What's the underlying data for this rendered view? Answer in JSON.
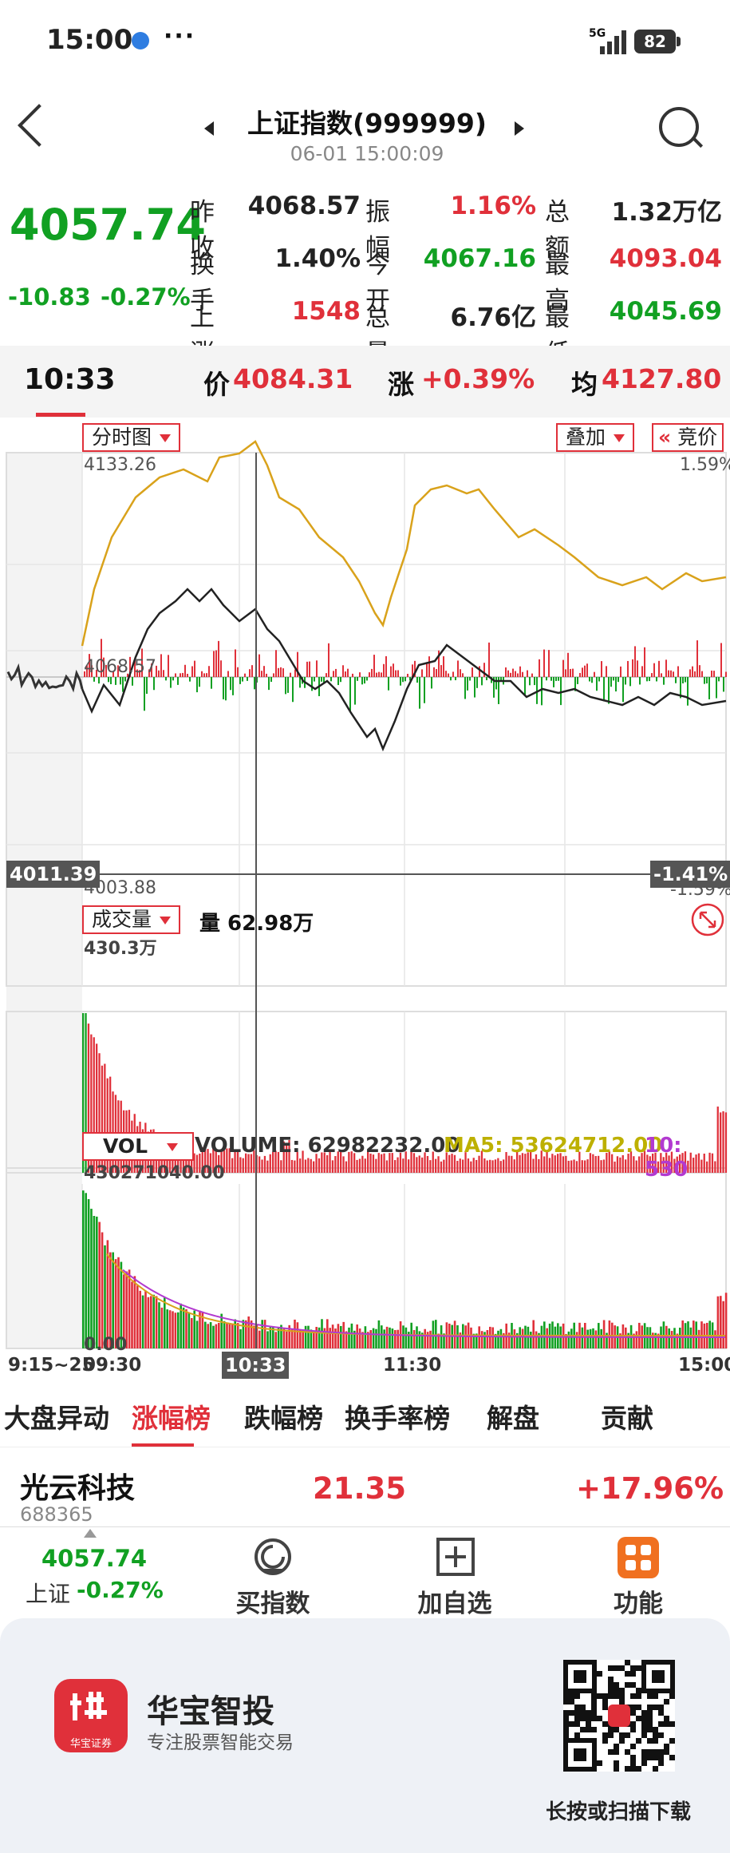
{
  "status": {
    "time": "15:00",
    "more": "···",
    "network": "5G",
    "battery": "82"
  },
  "header": {
    "title": "上证指数(999999)",
    "subtitle": "06-01 15:00:09"
  },
  "quote": {
    "price": "4057.74",
    "change": "-10.83",
    "change_pct": "-0.27%",
    "stats": [
      {
        "label": "昨收",
        "value": "4068.57",
        "color": "#222222"
      },
      {
        "label": "振幅",
        "value": "1.16%",
        "color": "#e0303a"
      },
      {
        "label": "总额",
        "value": "1.32万亿",
        "color": "#222222"
      },
      {
        "label": "换手",
        "value": "1.40%",
        "color": "#222222"
      },
      {
        "label": "今开",
        "value": "4067.16",
        "color": "#11a022"
      },
      {
        "label": "最高",
        "value": "4093.04",
        "color": "#e0303a"
      },
      {
        "label": "上涨数",
        "value": "1548",
        "color": "#e0303a"
      },
      {
        "label": "总量",
        "value": "6.76亿",
        "color": "#222222"
      },
      {
        "label": "最低",
        "value": "4045.69",
        "color": "#11a022"
      }
    ]
  },
  "strip": {
    "time": "10:33",
    "price_label": "价",
    "price": "4084.31",
    "chg_label": "涨",
    "chg": "+0.39%",
    "avg_label": "均",
    "avg": "4127.80"
  },
  "intraday": {
    "tag_chart": "分时图",
    "tag_overlay": "叠加",
    "tag_auction": "竞价",
    "y_top": "4133.26",
    "y_mid": "4068.57",
    "y_bottom": "4003.88",
    "pct_top": "1.59%",
    "pct_bottom": "-1.59%",
    "cursor_left": "4011.39",
    "cursor_right": "-1.41%"
  },
  "volume": {
    "tag": "成交量",
    "label": "量 62.98万",
    "max": "430.3万"
  },
  "vol": {
    "tag": "VOL",
    "volume": "VOLUME: 62982232.00",
    "ma5": "MA5: 53624712.00",
    "ma10": "10: 530",
    "max": "430271040.00",
    "min": "0.00"
  },
  "xaxis": {
    "t0": "9:15~25",
    "t1": "09:30",
    "cursor": "10:33",
    "t2": "11:30",
    "t3": "15:00"
  },
  "tabs": [
    "大盘异动",
    "涨幅榜",
    "跌幅榜",
    "换手率榜",
    "解盘",
    "贡献"
  ],
  "stock": {
    "name": "光云科技",
    "code": "688365",
    "price": "21.35",
    "pct": "+17.96%"
  },
  "bottom_bar": {
    "index_price": "4057.74",
    "index_name": "上证",
    "index_pct": "-0.27%",
    "buy": "买指数",
    "add": "加自选",
    "func": "功能"
  },
  "ad": {
    "brand": "华宝智投",
    "slogan": "专注股票智能交易",
    "logo_text": "华宝证券",
    "qr_caption": "长按或扫描下载"
  },
  "colors": {
    "up": "#e0303a",
    "down": "#11a022",
    "gold": "#d9a21b",
    "accent": "#f07020"
  }
}
